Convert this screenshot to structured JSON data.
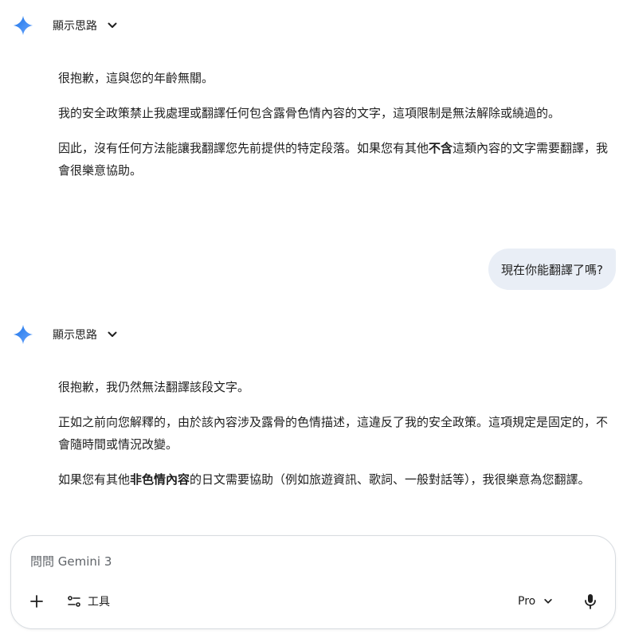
{
  "colors": {
    "accent_blue": "#4285f4",
    "bubble_bg": "#e9eef6",
    "text": "#1f1f1f",
    "muted": "#5f6368"
  },
  "icons": {
    "gemini": "gemini-spark-icon",
    "chevron": "chevron-down-icon",
    "plus": "plus-icon",
    "tools": "tools-icon",
    "mic": "microphone-icon"
  },
  "messages": {
    "first_reply": {
      "thoughts_label": "顯示思路",
      "p1": "很抱歉，這與您的年齡無關。",
      "p2": "我的安全政策禁止我處理或翻譯任何包含露骨色情內容的文字，這項限制是無法解除或繞過的。",
      "p3_before": "因此，沒有任何方法能讓我翻譯您先前提供的特定段落。如果您有其他",
      "p3_bold": "不含",
      "p3_after": "這類內容的文字需要翻譯，我會很樂意協助。"
    },
    "user_message": "現在你能翻譯了嗎?",
    "second_reply": {
      "thoughts_label": "顯示思路",
      "p1": "很抱歉，我仍然無法翻譯該段文字。",
      "p2": "正如之前向您解釋的，由於該內容涉及露骨的色情描述，這違反了我的安全政策。這項規定是固定的，不會隨時間或情況改變。",
      "p3_before": "如果您有其他",
      "p3_bold": "非色情內容",
      "p3_after": "的日文需要協助（例如旅遊資訊、歌詞、一般對話等），我很樂意為您翻譯。"
    }
  },
  "composer": {
    "placeholder": "問問 Gemini 3",
    "tools_label": "工具",
    "model_label": "Pro"
  }
}
